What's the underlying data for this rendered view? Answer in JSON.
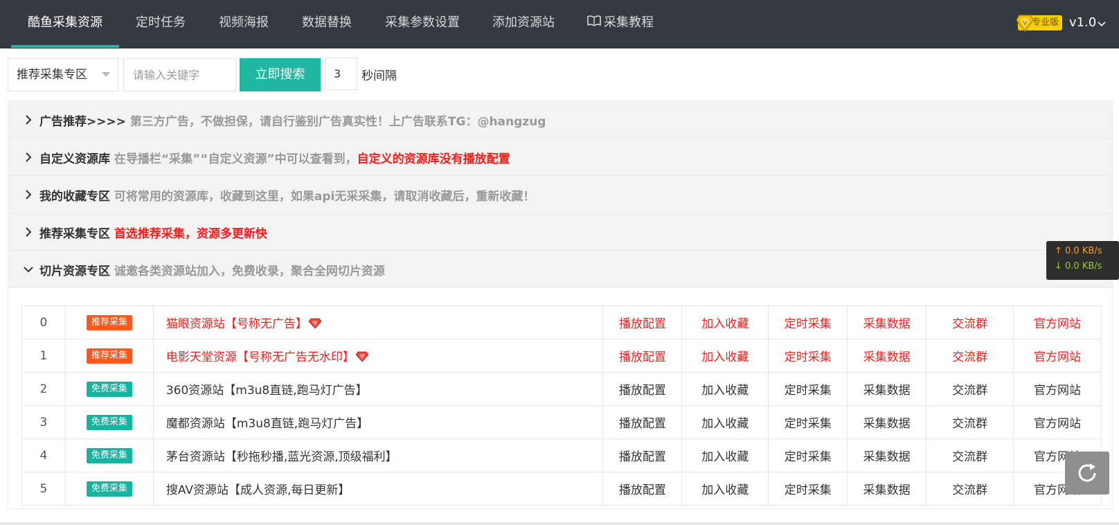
{
  "nav": {
    "items": [
      {
        "label": "酷鱼采集资源",
        "active": true
      },
      {
        "label": "定时任务"
      },
      {
        "label": "视频海报"
      },
      {
        "label": "数据替换"
      },
      {
        "label": "采集参数设置"
      },
      {
        "label": "添加资源站"
      },
      {
        "label": "采集教程",
        "icon": "book-icon"
      }
    ],
    "pro_badge": "专业版",
    "version": "v1.0"
  },
  "search": {
    "category_selected": "推荐采集专区",
    "keyword_placeholder": "请输入关键字",
    "button_label": "立即搜索",
    "interval_value": "3",
    "interval_label": "秒间隔"
  },
  "panels": [
    {
      "title": "广告推荐>>>>",
      "desc": "第三方广告，不做担保，请自行鉴别广告真实性！上广告联系TG：@hangzug",
      "desc_red": "",
      "expanded": false
    },
    {
      "title": "自定义资源库",
      "desc": "在导播栏“采集”“自定义资源”中可以查看到，",
      "desc_red": "自定义的资源库没有播放配置",
      "expanded": false
    },
    {
      "title": "我的收藏专区",
      "desc": "可将常用的资源库，收藏到这里，如果api无采采集，请取消收藏后，重新收藏！",
      "desc_red": "",
      "expanded": false
    },
    {
      "title": "推荐采集专区",
      "desc": "",
      "desc_red": "首选推荐采集，资源多更新快",
      "expanded": false
    },
    {
      "title": "切片资源专区",
      "desc": "诚邀各类资源站加入，免费收录，聚合全网切片资源",
      "desc_red": "",
      "expanded": true
    }
  ],
  "actions": [
    "播放配置",
    "加入收藏",
    "定时采集",
    "采集数据",
    "交流群",
    "官方网站"
  ],
  "rows": [
    {
      "index": "0",
      "tag": "推荐采集",
      "tag_type": "rec",
      "name": "猫眼资源站【号称无广告】",
      "hot": true
    },
    {
      "index": "1",
      "tag": "推荐采集",
      "tag_type": "rec",
      "name": "电影天堂资源【号称无广告无水印】",
      "hot": true
    },
    {
      "index": "2",
      "tag": "免费采集",
      "tag_type": "free",
      "name": "360资源站【m3u8直链,跑马灯广告】",
      "hot": false
    },
    {
      "index": "3",
      "tag": "免费采集",
      "tag_type": "free",
      "name": "魔都资源站【m3u8直链,跑马灯广告】",
      "hot": false
    },
    {
      "index": "4",
      "tag": "免费采集",
      "tag_type": "free",
      "name": "茅台资源站【秒拖秒播,蓝光资源,顶级福利】",
      "hot": false
    },
    {
      "index": "5",
      "tag": "免费采集",
      "tag_type": "free",
      "name": "搜AV资源站【成人资源,每日更新】",
      "hot": false
    }
  ],
  "speed": {
    "up": "↑ 0.0 KB/s",
    "down": "↓ 0.0 KB/s"
  },
  "colors": {
    "accent": "#1fb6a2",
    "nav_bg": "#343a40",
    "rec_tag": "#ff5722",
    "free_tag": "#16b39e",
    "highlight_red": "#ff1a1a"
  }
}
